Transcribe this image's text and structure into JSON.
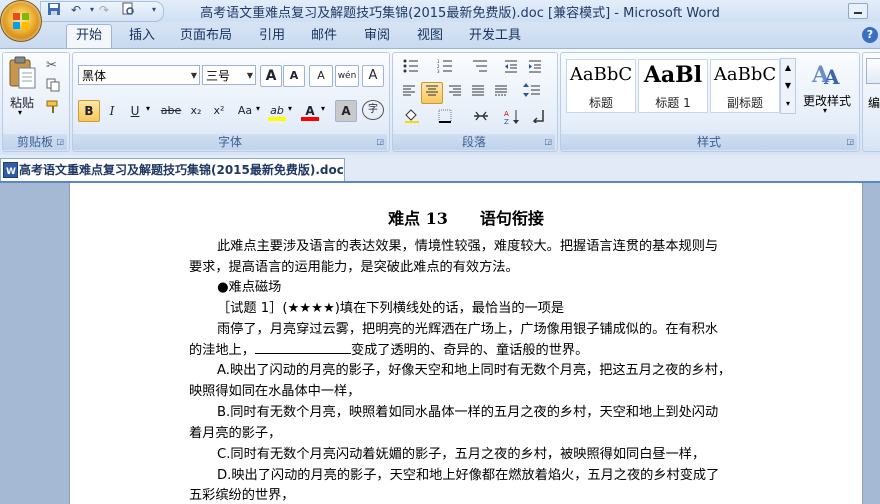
{
  "window": {
    "title": "高考语文重难点复习及解题技巧集锦(2015最新免费版).doc [兼容模式] - Microsoft Word"
  },
  "ribbon_tabs": [
    "开始",
    "插入",
    "页面布局",
    "引用",
    "邮件",
    "审阅",
    "视图",
    "开发工具"
  ],
  "clipboard": {
    "paste_label": "粘贴",
    "group_label": "剪贴板"
  },
  "font": {
    "font_name": "黑体",
    "font_size": "三号",
    "group_label": "字体",
    "bold": "B",
    "italic": "I",
    "underline": "U",
    "strike": "abe",
    "subscript": "x₂",
    "superscript": "x²",
    "change_case": "Aa",
    "grow": "A",
    "shrink": "A",
    "clear": "A",
    "phonetic": "wén",
    "border": "A",
    "highlight": "ab",
    "color": "A",
    "shade": "A",
    "enclose": "字"
  },
  "paragraph": {
    "group_label": "段落"
  },
  "styles": {
    "group_label": "样式",
    "tiles": [
      {
        "sample": "AaBbC",
        "name": "标题"
      },
      {
        "sample": "AaBl",
        "name": "标题 1"
      },
      {
        "sample": "AaBbC",
        "name": "副标题"
      }
    ],
    "change_styles_label": "更改样式",
    "edit_label": "编"
  },
  "document_tab": "高考语文重难点复习及解题技巧集锦(2015最新免费版).doc",
  "document": {
    "title": "难点 13　　语句衔接",
    "lines": [
      "此难点主要涉及语言的表达效果，情境性较强，难度较大。把握语言连贯的基本规则与",
      "要求，提高语言的运用能力，是突破此难点的有效方法。",
      "●难点磁场",
      "［试题 1］(★★★★)填在下列横线处的话，最恰当的一项是",
      "雨停了，月亮穿过云雾，把明亮的光辉洒在广场上，广场像用银子铺成似的。在有积水",
      "变成了透明的、奇异的、童话般的世界。",
      "A.映出了闪动的月亮的影子，好像天空和地上同时有无数个月亮，把这五月之夜的乡村，",
      "映照得如同在水晶体中一样，",
      "B.同时有无数个月亮，映照着如同水晶体一样的五月之夜的乡村，天空和地上到处闪动",
      "着月亮的影子，",
      "C.同时有无数个月亮闪动着妩媚的影子，五月之夜的乡村，被映照得如同白昼一样，",
      "D.映出了闪动的月亮的影子，天空和地上好像都在燃放着焰火，五月之夜的乡村变成了",
      "五彩缤纷的世界，"
    ],
    "blank_line_prefix": "的洼地上，"
  }
}
